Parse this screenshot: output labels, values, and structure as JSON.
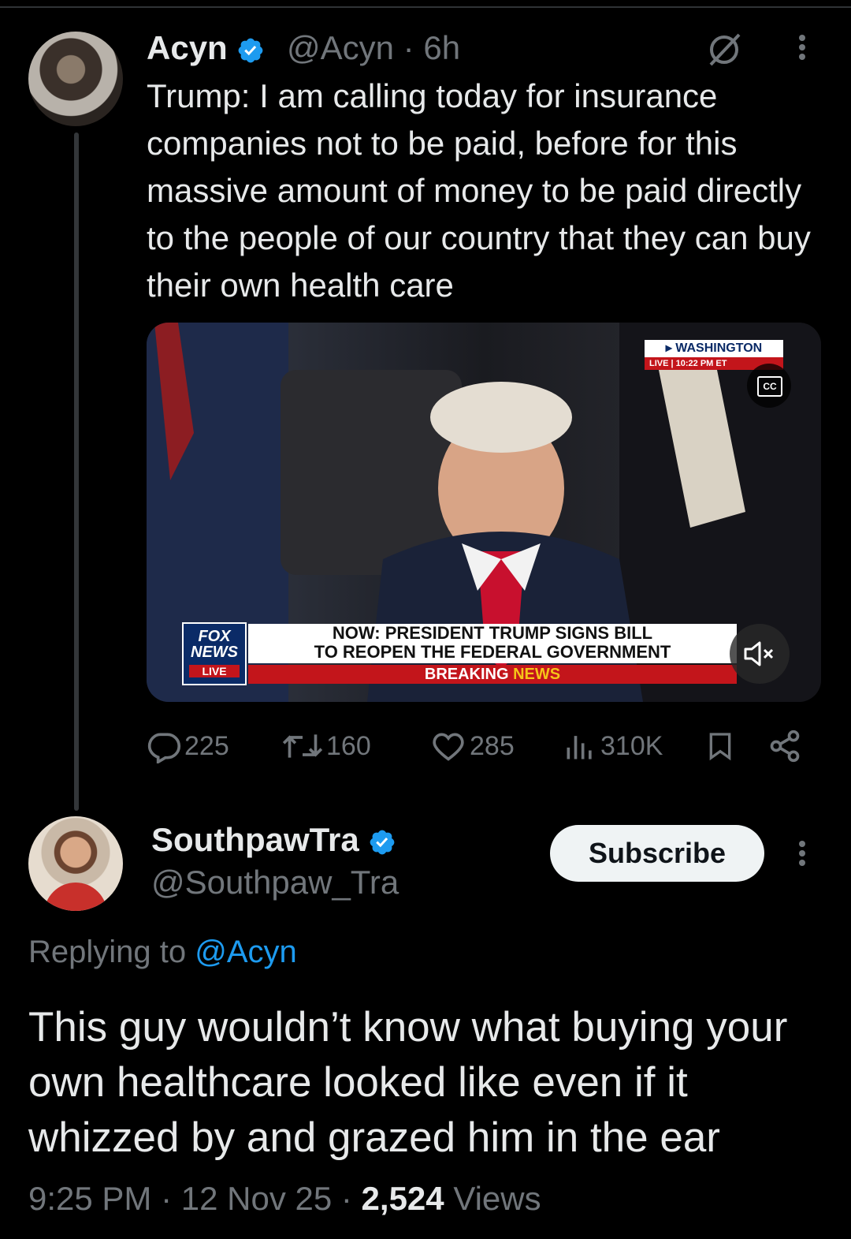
{
  "original_tweet": {
    "author_name": "Acyn",
    "handle": "@Acyn",
    "time": "6h",
    "text": "Trump: I am calling today for insurance companies not to be paid, before for this massive amount of money to be paid directly to the people of our country that they can buy their own health care",
    "video": {
      "location": "WASHINGTON",
      "live": "LIVE",
      "clock": "10:22 PM ET",
      "cc": "CC",
      "network_logo": "FOX NEWS",
      "network_live": "LIVE",
      "headline_line1": "NOW: PRESIDENT TRUMP SIGNS BILL",
      "headline_line2": "TO REOPEN THE FEDERAL GOVERNMENT",
      "breaking_1": "BREAKING",
      "breaking_2": "NEWS"
    },
    "stats": {
      "replies": "225",
      "reposts": "160",
      "likes": "285",
      "views": "310K"
    }
  },
  "reply": {
    "author_name": "SouthpawTra",
    "handle": "@Southpaw_Tra",
    "subscribe_label": "Subscribe",
    "replying_prefix": "Replying to",
    "replying_to": "@Acyn",
    "text": "This guy wouldn’t know what buying your own healthcare looked like even if it whizzed by and grazed him in the ear",
    "time": "9:25 PM",
    "date": "12 Nov 25",
    "views_count": "2,524",
    "views_label": "Views"
  },
  "colors": {
    "background": "#000000",
    "text_primary": "#e7e9ea",
    "text_secondary": "#71767b",
    "link": "#1d9bf0",
    "verified": "#1d9bf0"
  }
}
